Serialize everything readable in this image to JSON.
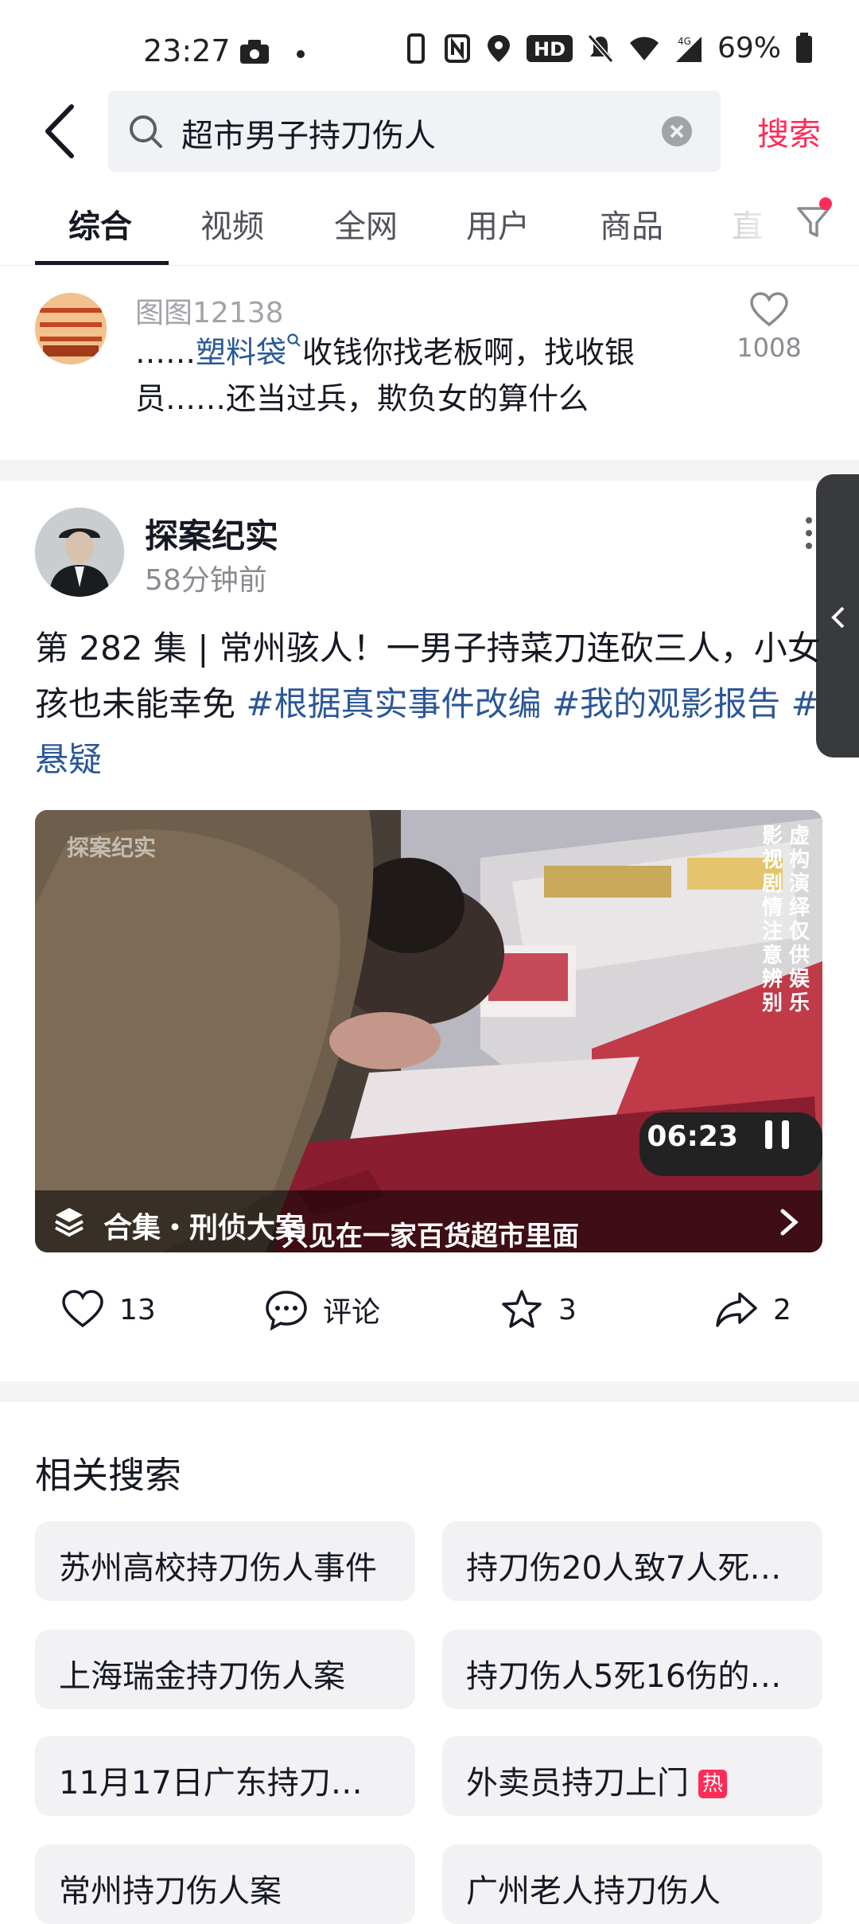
{
  "status_bar": {
    "time": "23:27",
    "battery": "69%",
    "network": "4G",
    "hd": "HD"
  },
  "search": {
    "query": "超市男子持刀伤人",
    "submit_label": "搜索"
  },
  "tabs": [
    {
      "label": "综合",
      "active": true
    },
    {
      "label": "视频"
    },
    {
      "label": "全网"
    },
    {
      "label": "用户"
    },
    {
      "label": "商品"
    },
    {
      "label": "直"
    }
  ],
  "comment_snippet": {
    "user": "图图12138",
    "prefix": "……",
    "link": "塑料袋",
    "text": "收钱你找老板啊，找收银员……还当过兵，欺负女的算什么",
    "likes": "1008"
  },
  "post": {
    "author": "探案纪实",
    "time": "58分钟前",
    "caption": "第 282 集 | 常州骇人！一男子持菜刀连砍三人，小女孩也未能幸免",
    "tags": [
      "#根据真实事件改编",
      "#我的观影报告",
      "#悬疑"
    ],
    "video": {
      "watermark": "探案纪实",
      "side_text_1": "影视剧情注意辨别",
      "side_text_2": "虚构演绎仅供娱乐",
      "duration": "06:23",
      "collection": "合集・刑侦大案",
      "subtitle": "只见在一家百货超市里面"
    },
    "actions": {
      "likes": "13",
      "comment_label": "评论",
      "favorites": "3",
      "shares": "2"
    }
  },
  "related": {
    "title": "相关搜索",
    "items": [
      {
        "label": "苏州高校持刀伤人事件"
      },
      {
        "label": "持刀伤20人致7人死…"
      },
      {
        "label": "上海瑞金持刀伤人案"
      },
      {
        "label": "持刀伤人5死16伤的…"
      },
      {
        "label": "11月17日广东持刀伤…"
      },
      {
        "label": "外卖员持刀上门",
        "badge": "热"
      },
      {
        "label": "常州持刀伤人案"
      },
      {
        "label": "广州老人持刀伤人"
      }
    ]
  },
  "colors": {
    "accent": "#fe2c55",
    "link": "#2b5797",
    "chip_bg": "#f2f2f4"
  }
}
